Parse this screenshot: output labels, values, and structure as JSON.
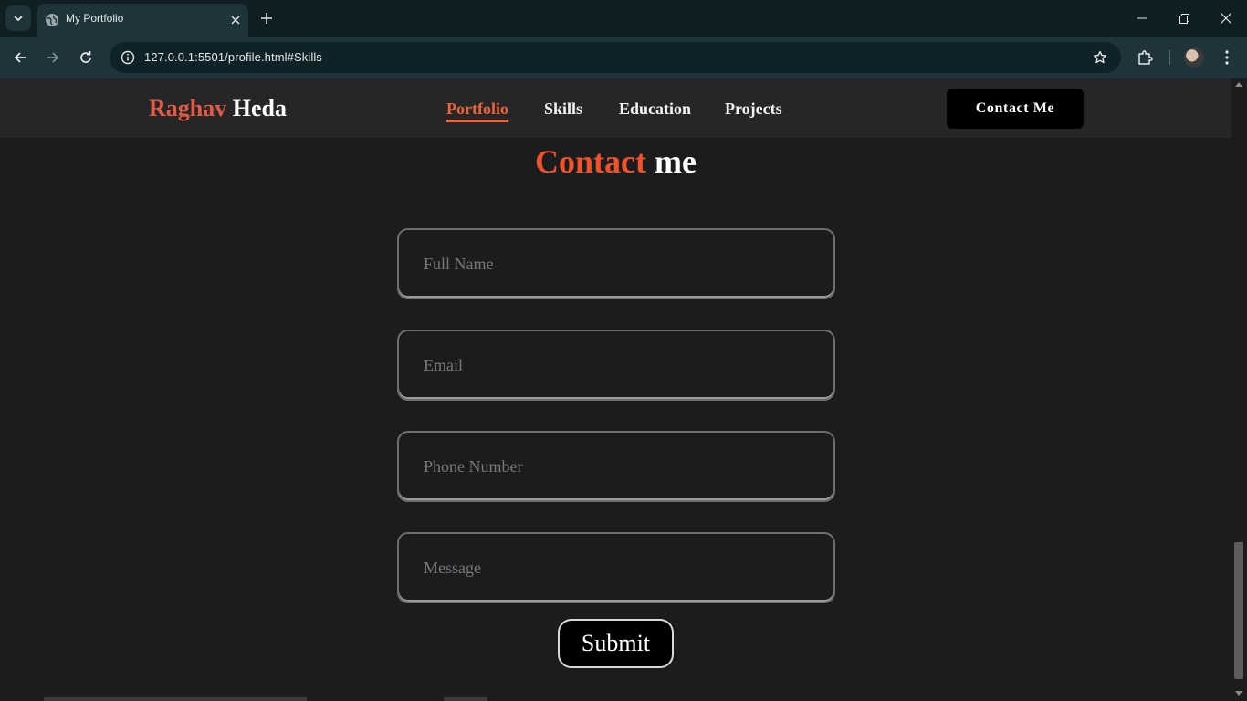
{
  "browser": {
    "tab_title": "My Portfolio",
    "url": "127.0.0.1:5501/profile.html#Skills"
  },
  "navbar": {
    "logo_first": "Raghav",
    "logo_last": "Heda",
    "links": [
      "Portfolio",
      "Skills",
      "Education",
      "Projects"
    ],
    "active_link": "Portfolio",
    "contact_button": "Contact Me"
  },
  "contact": {
    "heading_accent": "Contact",
    "heading_rest": "me",
    "placeholders": {
      "full_name": "Full Name",
      "email": "Email",
      "phone": "Phone Number",
      "message": "Message"
    },
    "submit_label": "Submit"
  },
  "colors": {
    "accent": "#f1522a",
    "logo_accent": "#e35a45",
    "page_bg": "#1b1c1e",
    "navbar_bg": "#242628"
  },
  "icons": [
    "tab-search-icon",
    "globe-icon",
    "close-icon",
    "plus-icon",
    "minimize-icon",
    "restore-icon",
    "back-arrow-icon",
    "forward-arrow-icon",
    "reload-icon",
    "site-info-icon",
    "star-icon",
    "extensions-icon",
    "profile-avatar",
    "more-vert-icon"
  ]
}
